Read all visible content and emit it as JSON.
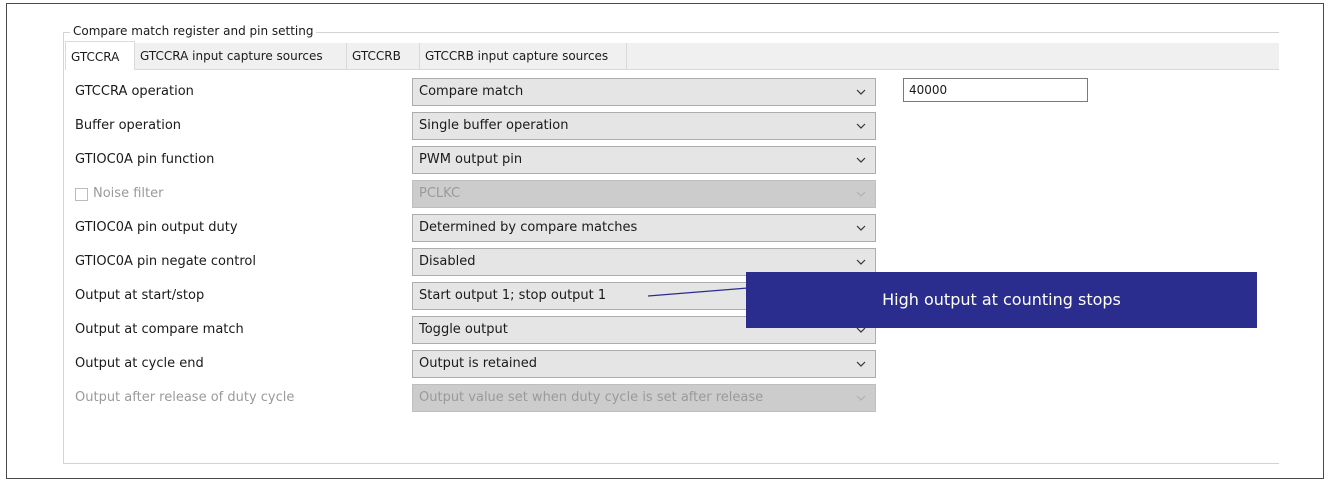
{
  "group": {
    "title": "Compare match register and pin setting"
  },
  "tabs": [
    {
      "label": "GTCCRA",
      "active": true
    },
    {
      "label": "GTCCRA input capture sources",
      "active": false
    },
    {
      "label": "GTCCRB",
      "active": false
    },
    {
      "label": "GTCCRB input capture sources",
      "active": false
    }
  ],
  "rows": [
    {
      "label": "GTCCRA operation",
      "value": "Compare match",
      "enabled": true
    },
    {
      "label": "Buffer operation",
      "value": "Single buffer operation",
      "enabled": true
    },
    {
      "label": "GTIOC0A pin function",
      "value": "PWM output pin",
      "enabled": true
    },
    {
      "label": "Noise filter",
      "value": "PCLKC",
      "enabled": false,
      "checkbox": false
    },
    {
      "label": "GTIOC0A pin output duty",
      "value": "Determined by compare matches",
      "enabled": true
    },
    {
      "label": "GTIOC0A pin negate control",
      "value": "Disabled",
      "enabled": true
    },
    {
      "label": "Output at start/stop",
      "value": "Start output 1; stop output 1",
      "enabled": true
    },
    {
      "label": "Output at compare match",
      "value": "Toggle output",
      "enabled": true
    },
    {
      "label": "Output at cycle end",
      "value": "Output is retained",
      "enabled": true
    },
    {
      "label": "Output after release of duty cycle",
      "value": "Output value set when duty cycle is set after release",
      "enabled": false
    }
  ],
  "compare_value": "40000",
  "callout": {
    "text": "High output at counting stops"
  },
  "icons": {
    "dropdown": "chevron-down-icon"
  },
  "colors": {
    "callout_bg": "#2b2d8e",
    "callout_text": "#ffffff"
  }
}
